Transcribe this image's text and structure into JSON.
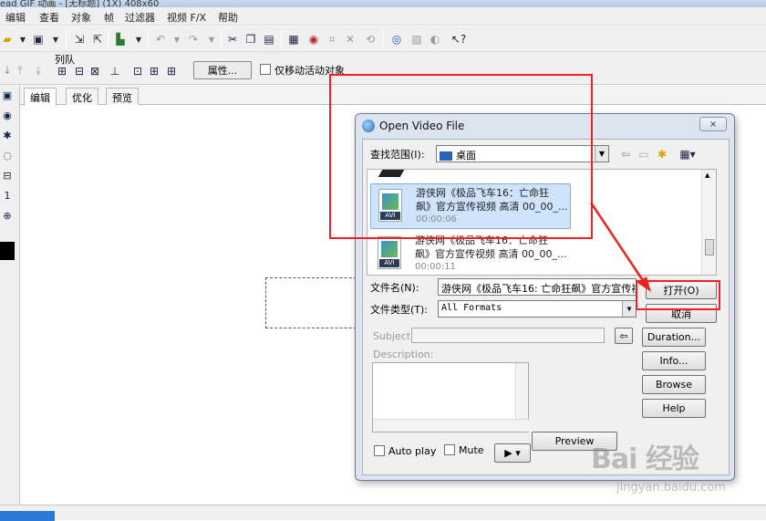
{
  "window": {
    "title": "ead GIF 动画 - [无标题] (1X) 408x60"
  },
  "menu": {
    "items": [
      "编辑",
      "查看",
      "对象",
      "帧",
      "过滤器",
      "视频 F/X",
      "帮助"
    ]
  },
  "toolbar2": {
    "group_label": "列队",
    "properties_button": "属性...",
    "only_move_checkbox": "仅移动活动对象"
  },
  "tabs": [
    "编辑",
    "优化",
    "预览"
  ],
  "dialog": {
    "title": "Open Video File",
    "close_label": "×",
    "look_in_label": "查找范围(I):",
    "look_in_value": "桌面",
    "files": [
      {
        "name_line1": "游侠网《极品飞车16：亡命狂",
        "name_line2": "飙》官方宣传视频 高清 00_00_...",
        "duration": "00:00:06",
        "badge": "AVI"
      },
      {
        "name_line1": "游侠网《极品飞车16：亡命狂",
        "name_line2": "飙》官方宣传视频 高清 00_00_...",
        "duration": "00:00:11",
        "badge": "AVI"
      }
    ],
    "filename_label": "文件名(N):",
    "filename_value": "游侠网《极品飞车16: 亡命狂飙》官方宣传视",
    "filetype_label": "文件类型(T):",
    "filetype_value": "All Formats",
    "open_button": "打开(O)",
    "cancel_button": "取消",
    "subject_label": "Subject:",
    "description_label": "Description:",
    "duration_button": "Duration...",
    "info_button": "Info...",
    "browse_button": "Browse",
    "help_button": "Help",
    "preview_button": "Preview",
    "autoplay_label": "Auto play",
    "mute_label": "Mute",
    "play_button": "▶ ▾"
  },
  "watermark": {
    "text": "Bai 经验",
    "url": "jingyan.baidu.com"
  },
  "colors": {
    "annotation_red": "#e22222",
    "selection_blue": "#cfe3fb"
  }
}
